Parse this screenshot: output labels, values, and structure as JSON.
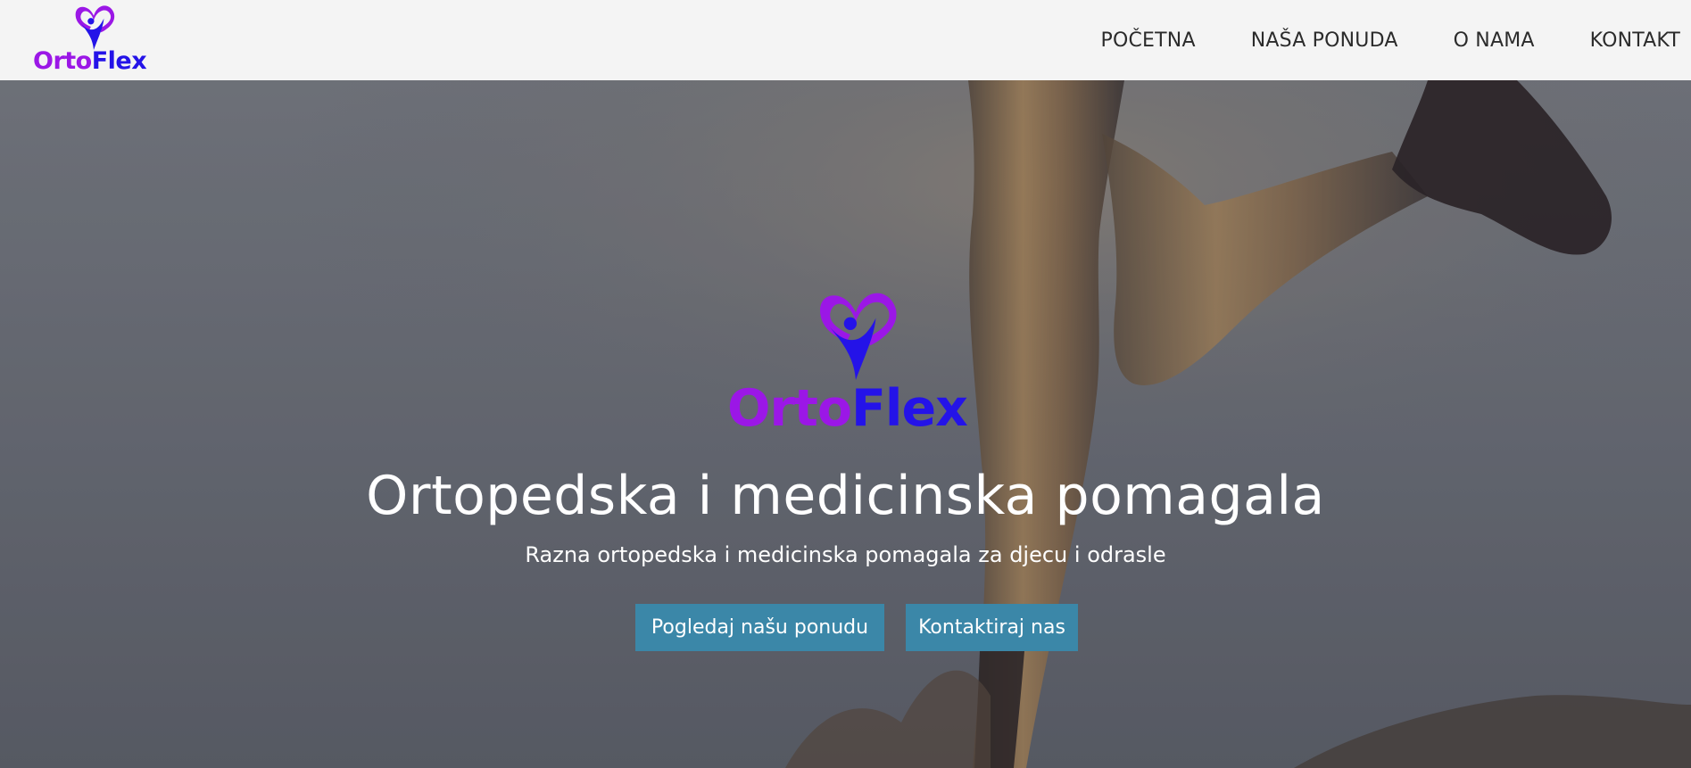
{
  "brand": {
    "name_part1": "Orto",
    "name_part2": "Flex",
    "colors": {
      "purple": "#9b17e6",
      "blue": "#2413e8"
    },
    "icon": "heart-person-logo-icon"
  },
  "nav": {
    "items": [
      {
        "label": "POČETNA"
      },
      {
        "label": "NAŠA PONUDA"
      },
      {
        "label": "O NAMA"
      },
      {
        "label": "KONTAKT"
      }
    ]
  },
  "hero": {
    "title": "Ortopedska i medicinska pomagala",
    "subtitle": "Razna ortopedska i medicinska pomagala za djecu i odrasle",
    "buttons": {
      "offer": "Pogledaj našu ponudu",
      "contact": "Kontaktiraj nas"
    },
    "button_color": "#3b87a8",
    "background": "runner-legs-photo-dark-overlay"
  }
}
